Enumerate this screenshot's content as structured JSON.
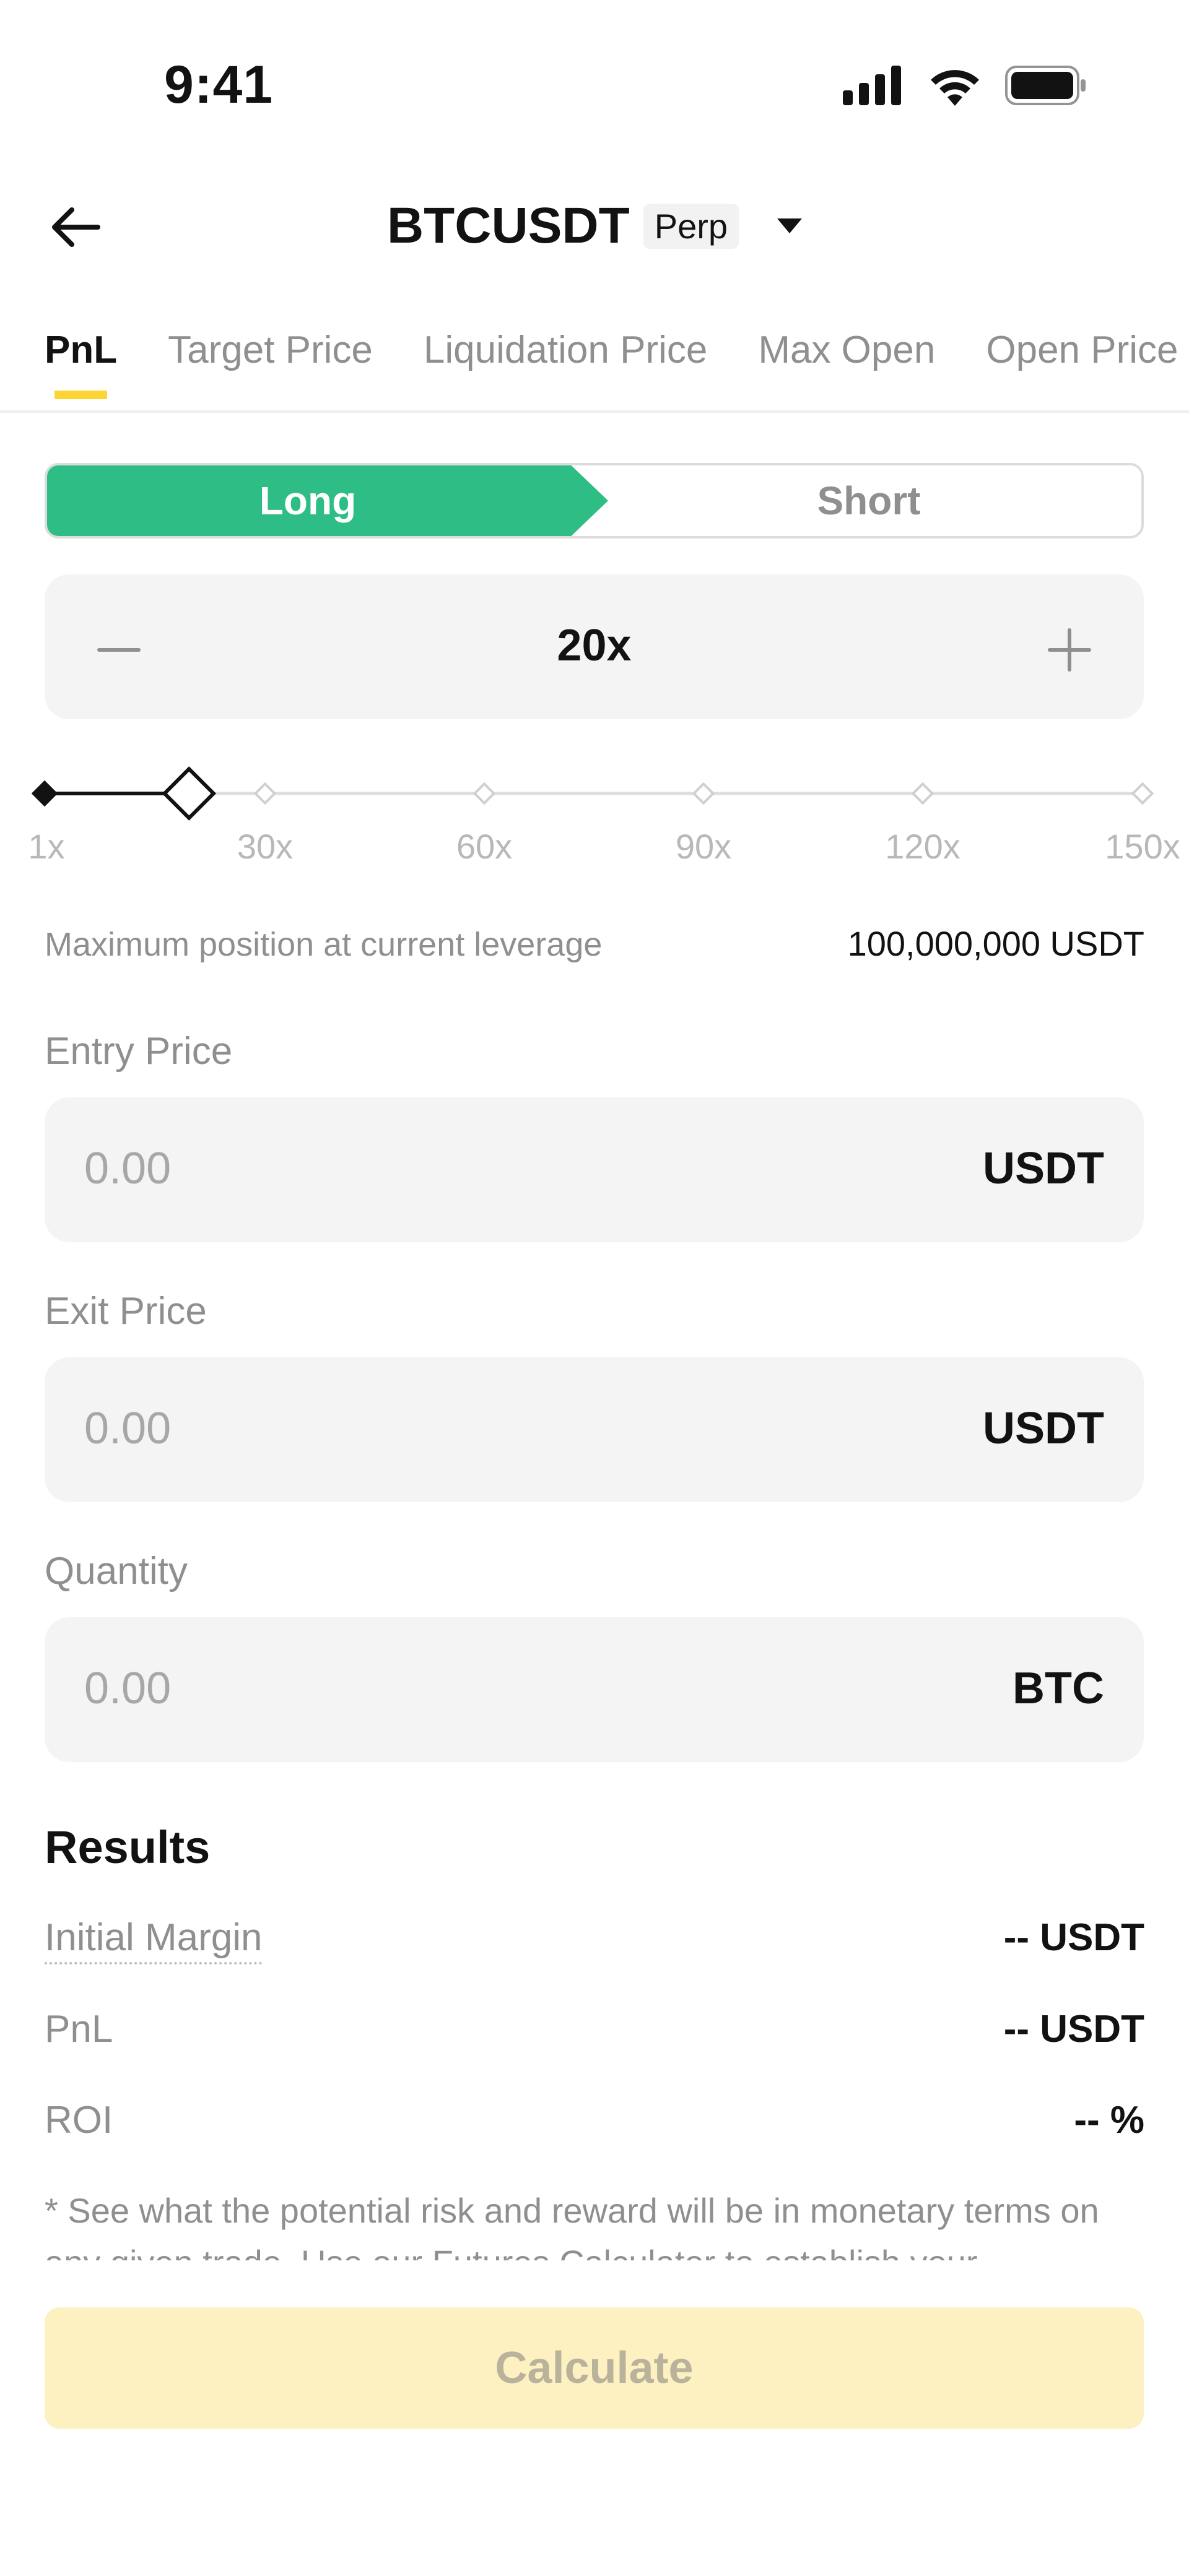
{
  "status_bar": {
    "time": "9:41"
  },
  "header": {
    "title": "BTCUSDT",
    "badge": "Perp"
  },
  "tabs": [
    {
      "label": "PnL",
      "active": true
    },
    {
      "label": "Target Price",
      "active": false
    },
    {
      "label": "Liquidation Price",
      "active": false
    },
    {
      "label": "Max Open",
      "active": false
    },
    {
      "label": "Open Price",
      "active": false
    }
  ],
  "position_side": {
    "long_label": "Long",
    "short_label": "Short",
    "selected": "Long"
  },
  "leverage": {
    "value_label": "20x",
    "value": 20,
    "min": 1,
    "max": 150,
    "ticks": [
      "1x",
      "30x",
      "60x",
      "90x",
      "120x",
      "150x"
    ]
  },
  "max_position": {
    "label": "Maximum position at current leverage",
    "value": "100,000,000 USDT"
  },
  "fields": {
    "entry_price": {
      "label": "Entry Price",
      "placeholder": "0.00",
      "unit": "USDT"
    },
    "exit_price": {
      "label": "Exit Price",
      "placeholder": "0.00",
      "unit": "USDT"
    },
    "quantity": {
      "label": "Quantity",
      "placeholder": "0.00",
      "unit": "BTC"
    }
  },
  "results": {
    "title": "Results",
    "initial_margin": {
      "label": "Initial Margin",
      "value": "-- USDT"
    },
    "pnl": {
      "label": "PnL",
      "value": "-- USDT"
    },
    "roi": {
      "label": "ROI",
      "value": "-- %"
    }
  },
  "disclaimer": "* See what the potential risk and reward will be in monetary terms on any given trade. Use our Futures Calculator to establish your",
  "calculate_label": "Calculate",
  "colors": {
    "long": "#2ebd85",
    "accent": "#fcd535",
    "calc_disabled": "#fdf1c2"
  }
}
